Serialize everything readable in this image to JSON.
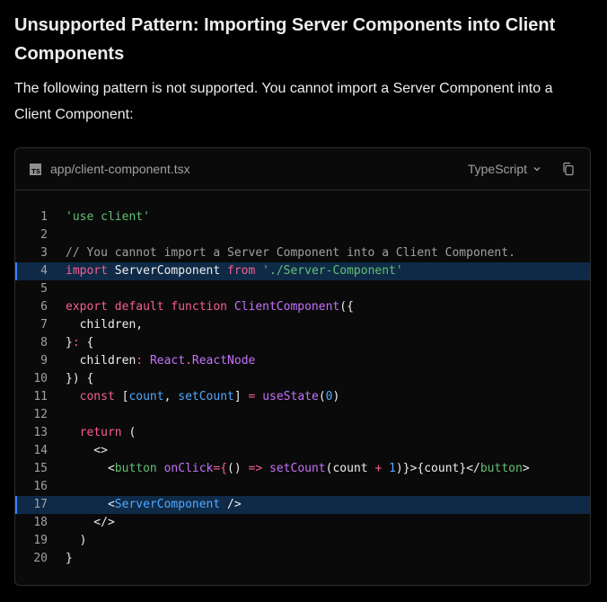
{
  "heading": "Unsupported Pattern: Importing Server Components into Client Components",
  "description": "The following pattern is not supported. You cannot import a Server Component into a Client Component:",
  "code_block": {
    "badge": "TS",
    "filename": "app/client-component.tsx",
    "language_label": "TypeScript",
    "highlighted_lines": [
      4,
      17
    ],
    "lines": [
      {
        "n": "1",
        "tokens": [
          {
            "t": "'use client'",
            "c": "str"
          }
        ]
      },
      {
        "n": "2",
        "tokens": []
      },
      {
        "n": "3",
        "tokens": [
          {
            "t": "// You cannot import a Server Component into a Client Component.",
            "c": "cmt"
          }
        ]
      },
      {
        "n": "4",
        "tokens": [
          {
            "t": "import ",
            "c": "kw"
          },
          {
            "t": "ServerComponent ",
            "c": "id"
          },
          {
            "t": "from ",
            "c": "kw"
          },
          {
            "t": "'./Server-Component'",
            "c": "str"
          }
        ]
      },
      {
        "n": "5",
        "tokens": []
      },
      {
        "n": "6",
        "tokens": [
          {
            "t": "export default function ",
            "c": "kw"
          },
          {
            "t": "ClientComponent",
            "c": "fn"
          },
          {
            "t": "({",
            "c": "plain"
          }
        ]
      },
      {
        "n": "7",
        "tokens": [
          {
            "t": "  children,",
            "c": "plain"
          }
        ]
      },
      {
        "n": "8",
        "tokens": [
          {
            "t": "}",
            "c": "plain"
          },
          {
            "t": ": ",
            "c": "kw"
          },
          {
            "t": "{",
            "c": "plain"
          }
        ]
      },
      {
        "n": "9",
        "tokens": [
          {
            "t": "  children",
            "c": "plain"
          },
          {
            "t": ": ",
            "c": "kw"
          },
          {
            "t": "React",
            "c": "fn"
          },
          {
            "t": ".",
            "c": "kw"
          },
          {
            "t": "ReactNode",
            "c": "fn"
          }
        ]
      },
      {
        "n": "10",
        "tokens": [
          {
            "t": "}) {",
            "c": "plain"
          }
        ]
      },
      {
        "n": "11",
        "tokens": [
          {
            "t": "  const ",
            "c": "kw"
          },
          {
            "t": "[",
            "c": "plain"
          },
          {
            "t": "count",
            "c": "var"
          },
          {
            "t": ", ",
            "c": "plain"
          },
          {
            "t": "setCount",
            "c": "var"
          },
          {
            "t": "] ",
            "c": "plain"
          },
          {
            "t": "= ",
            "c": "kw"
          },
          {
            "t": "useState",
            "c": "fn"
          },
          {
            "t": "(",
            "c": "plain"
          },
          {
            "t": "0",
            "c": "num"
          },
          {
            "t": ")",
            "c": "plain"
          }
        ]
      },
      {
        "n": "12",
        "tokens": []
      },
      {
        "n": "13",
        "tokens": [
          {
            "t": "  return ",
            "c": "kw"
          },
          {
            "t": "(",
            "c": "plain"
          }
        ]
      },
      {
        "n": "14",
        "tokens": [
          {
            "t": "    <>",
            "c": "plain"
          }
        ]
      },
      {
        "n": "15",
        "tokens": [
          {
            "t": "      <",
            "c": "plain"
          },
          {
            "t": "button ",
            "c": "tag"
          },
          {
            "t": "onClick",
            "c": "fn"
          },
          {
            "t": "={",
            "c": "kw"
          },
          {
            "t": "() ",
            "c": "plain"
          },
          {
            "t": "=> ",
            "c": "kw"
          },
          {
            "t": "setCount",
            "c": "fn"
          },
          {
            "t": "(count ",
            "c": "plain"
          },
          {
            "t": "+ ",
            "c": "kw"
          },
          {
            "t": "1",
            "c": "num"
          },
          {
            "t": ")}>{count}</",
            "c": "plain"
          },
          {
            "t": "button",
            "c": "tag"
          },
          {
            "t": ">",
            "c": "plain"
          }
        ]
      },
      {
        "n": "16",
        "tokens": []
      },
      {
        "n": "17",
        "tokens": [
          {
            "t": "      <",
            "c": "plain"
          },
          {
            "t": "ServerComponent",
            "c": "var"
          },
          {
            "t": " />",
            "c": "plain"
          }
        ]
      },
      {
        "n": "18",
        "tokens": [
          {
            "t": "    </>",
            "c": "plain"
          }
        ]
      },
      {
        "n": "19",
        "tokens": [
          {
            "t": "  )",
            "c": "plain"
          }
        ]
      },
      {
        "n": "20",
        "tokens": [
          {
            "t": "}",
            "c": "plain"
          }
        ]
      }
    ]
  },
  "icons": {
    "file_type": "typescript-file-icon",
    "language_dropdown": "chevron-down-icon",
    "copy": "copy-icon"
  }
}
